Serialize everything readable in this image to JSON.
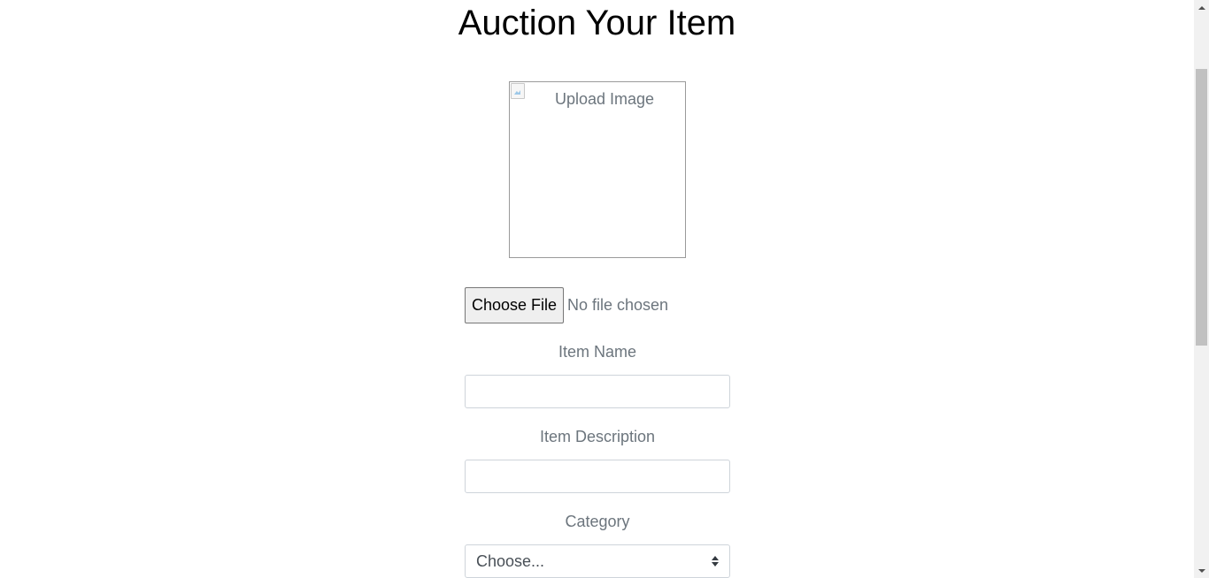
{
  "header": {
    "title": "Auction Your Item"
  },
  "image_upload": {
    "alt_text": "Upload Image"
  },
  "file_input": {
    "button_label": "Choose File",
    "status": "No file chosen"
  },
  "form": {
    "item_name": {
      "label": "Item Name",
      "value": ""
    },
    "item_description": {
      "label": "Item Description",
      "value": ""
    },
    "category": {
      "label": "Category",
      "selected": "Choose..."
    }
  },
  "icons": {
    "broken_image": "broken-image-icon",
    "select_arrows": "select-arrows-icon",
    "scroll_up": "scroll-up-icon",
    "scroll_down": "scroll-down-icon"
  },
  "colors": {
    "muted_text": "#6c757d",
    "input_border": "#ced4da",
    "title_text": "#000000"
  }
}
